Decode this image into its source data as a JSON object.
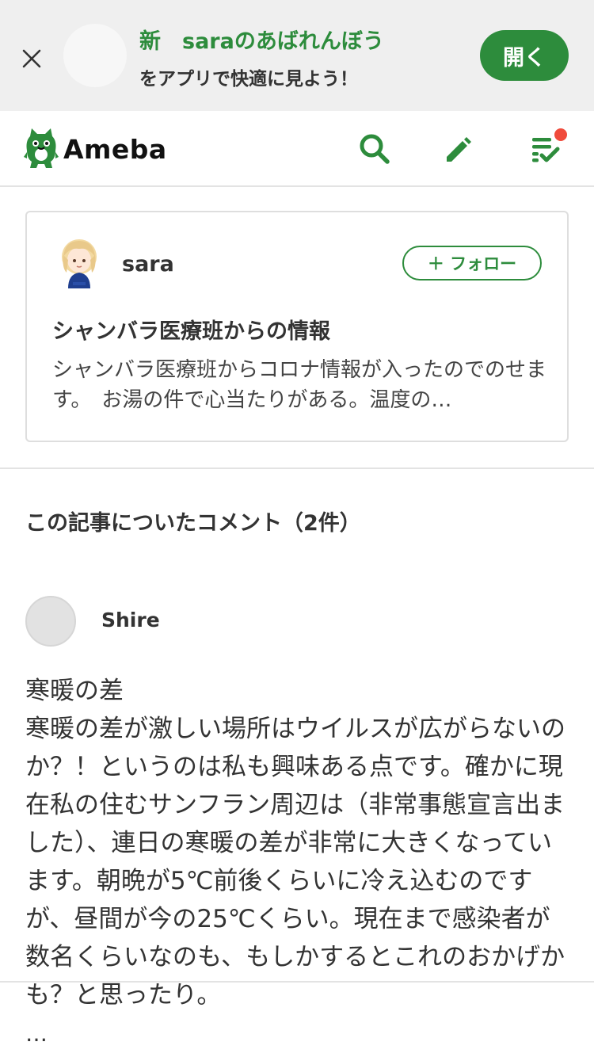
{
  "banner": {
    "title": "新　saraのあばれんぼう",
    "subtitle": "をアプリで快適に見よう！",
    "open_label": "開く"
  },
  "header": {
    "logo_text": "Ameba",
    "icons": [
      "search-icon",
      "pencil-icon",
      "checklist-icon"
    ],
    "notification": true
  },
  "article": {
    "author": "sara",
    "follow_label": "＋ フォロー",
    "title": "シャンバラ医療班からの情報",
    "excerpt": "シャンバラ医療班からコロナ情報が入ったのでのせます。　お湯の件で心当たりがある。温度の…"
  },
  "comments": {
    "heading": "この記事についたコメント（2件）",
    "items": [
      {
        "name": "Shire",
        "title": "寒暖の差",
        "body": "寒暖の差が激しい場所はウイルスが広がらないのか？！というのは私も興味ある点です。確かに現在私の住むサンフラン周辺は（非常事態宣言出ました）、連日の寒暖の差が非常に大きくなっています。朝晩が5℃前後くらいに冷え込むのですが、昼間が今の25℃くらい。現在まで感染者が数名くらいなのも、もしかするとこれのおかげかも？と思ったり。",
        "more": "…"
      }
    ]
  },
  "colors": {
    "accent": "#2d8c3c",
    "notification": "#f04b3c"
  }
}
